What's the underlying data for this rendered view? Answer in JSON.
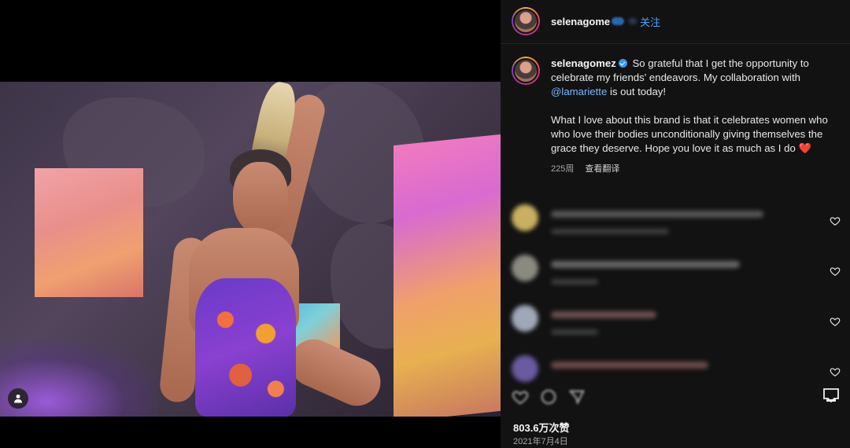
{
  "header": {
    "username": "selenagome",
    "follow_label": "关注"
  },
  "caption": {
    "username": "selenagomez",
    "text_1": "So grateful that I get the opportunity to celebrate my friends' endeavors. My collaboration with ",
    "mention": "@lamariette",
    "text_2": " is out today!",
    "text_3": "What I love about this brand is that it celebrates women who who love their bodies unconditionally giving themselves the grace they deserve. Hope you love it as much as I do",
    "emoji": "❤️",
    "time_ago": "225周",
    "translate_label": "查看翻译"
  },
  "comments_count_visible": 4,
  "likes": "803.6万次赞",
  "date": "2021年7月4日",
  "icons": {
    "person_tag": "person-icon",
    "comment_like": "heart-outline-icon",
    "actions": [
      "heart-icon",
      "comment-icon",
      "share-icon"
    ],
    "save": "bookmark-icon"
  },
  "colors": {
    "accent_link": "#4aa3ff",
    "background_panel": "#121212",
    "verified": "#3897f0"
  }
}
